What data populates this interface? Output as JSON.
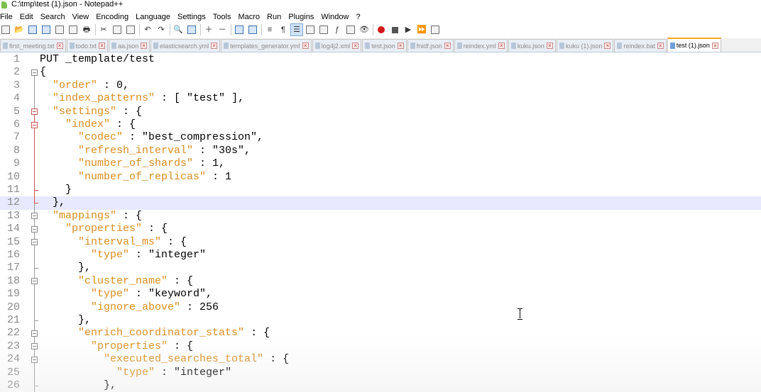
{
  "window": {
    "title": "C:\\tmp\\test (1).json - Notepad++"
  },
  "menu": [
    "File",
    "Edit",
    "Search",
    "View",
    "Encoding",
    "Language",
    "Settings",
    "Tools",
    "Macro",
    "Run",
    "Plugins",
    "Window",
    "?"
  ],
  "tabs": [
    {
      "label": "first_meeting.txt",
      "active": false
    },
    {
      "label": "todo.txt",
      "active": false
    },
    {
      "label": "aa.json",
      "active": false
    },
    {
      "label": "elasticsearch.yml",
      "active": false
    },
    {
      "label": "templates_generator.yml",
      "active": false
    },
    {
      "label": "log4j2.xml",
      "active": false
    },
    {
      "label": "test.json",
      "active": false
    },
    {
      "label": "fnidf.json",
      "active": false
    },
    {
      "label": "reindex.yml",
      "active": false
    },
    {
      "label": "kuku.json",
      "active": false
    },
    {
      "label": "kuku (1).json",
      "active": false
    },
    {
      "label": "reindex.bat",
      "active": false
    },
    {
      "label": "test (1).json",
      "active": true
    }
  ],
  "editor": {
    "current_line": 12,
    "lines": [
      {
        "n": "1",
        "segments": [
          [
            "s",
            "PUT _template/test"
          ]
        ]
      },
      {
        "n": "2",
        "segments": [
          [
            "s",
            "{"
          ]
        ]
      },
      {
        "n": "3",
        "segments": [
          [
            "s",
            "  "
          ],
          [
            "k",
            "\"order\""
          ],
          [
            "s",
            " : 0,"
          ]
        ]
      },
      {
        "n": "4",
        "segments": [
          [
            "s",
            "  "
          ],
          [
            "k",
            "\"index_patterns\""
          ],
          [
            "s",
            " : [ \"test\" ],"
          ]
        ]
      },
      {
        "n": "5",
        "segments": [
          [
            "s",
            "  "
          ],
          [
            "k",
            "\"settings\""
          ],
          [
            "s",
            " : {"
          ]
        ]
      },
      {
        "n": "6",
        "segments": [
          [
            "s",
            "    "
          ],
          [
            "k",
            "\"index\""
          ],
          [
            "s",
            " : {"
          ]
        ]
      },
      {
        "n": "7",
        "segments": [
          [
            "s",
            "      "
          ],
          [
            "k",
            "\"codec\""
          ],
          [
            "s",
            " : \"best_compression\","
          ]
        ]
      },
      {
        "n": "8",
        "segments": [
          [
            "s",
            "      "
          ],
          [
            "k",
            "\"refresh_interval\""
          ],
          [
            "s",
            " : \"30s\","
          ]
        ]
      },
      {
        "n": "9",
        "segments": [
          [
            "s",
            "      "
          ],
          [
            "k",
            "\"number_of_shards\""
          ],
          [
            "s",
            " : 1,"
          ]
        ]
      },
      {
        "n": "10",
        "segments": [
          [
            "s",
            "      "
          ],
          [
            "k",
            "\"number_of_replicas\""
          ],
          [
            "s",
            " : 1"
          ]
        ]
      },
      {
        "n": "11",
        "segments": [
          [
            "s",
            "    }"
          ]
        ]
      },
      {
        "n": "12",
        "segments": [
          [
            "s",
            "  },"
          ]
        ]
      },
      {
        "n": "13",
        "segments": [
          [
            "s",
            "  "
          ],
          [
            "k",
            "\"mappings\""
          ],
          [
            "s",
            " : {"
          ]
        ]
      },
      {
        "n": "14",
        "segments": [
          [
            "s",
            "    "
          ],
          [
            "k",
            "\"properties\""
          ],
          [
            "s",
            " : {"
          ]
        ]
      },
      {
        "n": "15",
        "segments": [
          [
            "s",
            "      "
          ],
          [
            "k",
            "\"interval_ms\""
          ],
          [
            "s",
            " : {"
          ]
        ]
      },
      {
        "n": "16",
        "segments": [
          [
            "s",
            "        "
          ],
          [
            "k",
            "\"type\""
          ],
          [
            "s",
            " : \"integer\""
          ]
        ]
      },
      {
        "n": "17",
        "segments": [
          [
            "s",
            "      },"
          ]
        ]
      },
      {
        "n": "18",
        "segments": [
          [
            "s",
            "      "
          ],
          [
            "k",
            "\"cluster_name\""
          ],
          [
            "s",
            " : {"
          ]
        ]
      },
      {
        "n": "19",
        "segments": [
          [
            "s",
            "        "
          ],
          [
            "k",
            "\"type\""
          ],
          [
            "s",
            " : \"keyword\","
          ]
        ]
      },
      {
        "n": "20",
        "segments": [
          [
            "s",
            "        "
          ],
          [
            "k",
            "\"ignore_above\""
          ],
          [
            "s",
            " : 256"
          ]
        ]
      },
      {
        "n": "21",
        "segments": [
          [
            "s",
            "      },"
          ]
        ]
      },
      {
        "n": "22",
        "segments": [
          [
            "s",
            "      "
          ],
          [
            "k",
            "\"enrich_coordinator_stats\""
          ],
          [
            "s",
            " : {"
          ]
        ]
      },
      {
        "n": "23",
        "segments": [
          [
            "s",
            "        "
          ],
          [
            "k",
            "\"properties\""
          ],
          [
            "s",
            " : {"
          ]
        ]
      },
      {
        "n": "24",
        "segments": [
          [
            "s",
            "          "
          ],
          [
            "k",
            "\"executed_searches_total\""
          ],
          [
            "s",
            " : {"
          ]
        ]
      },
      {
        "n": "25",
        "segments": [
          [
            "s",
            "            "
          ],
          [
            "k",
            "\"type\""
          ],
          [
            "s",
            " : \"integer\""
          ]
        ]
      },
      {
        "n": "26",
        "segments": [
          [
            "s",
            "          },"
          ]
        ]
      }
    ]
  },
  "colors": {
    "key": "#d98d1f",
    "current_line": "#e8e8ff",
    "active_tab_accent": "#f5a623"
  }
}
